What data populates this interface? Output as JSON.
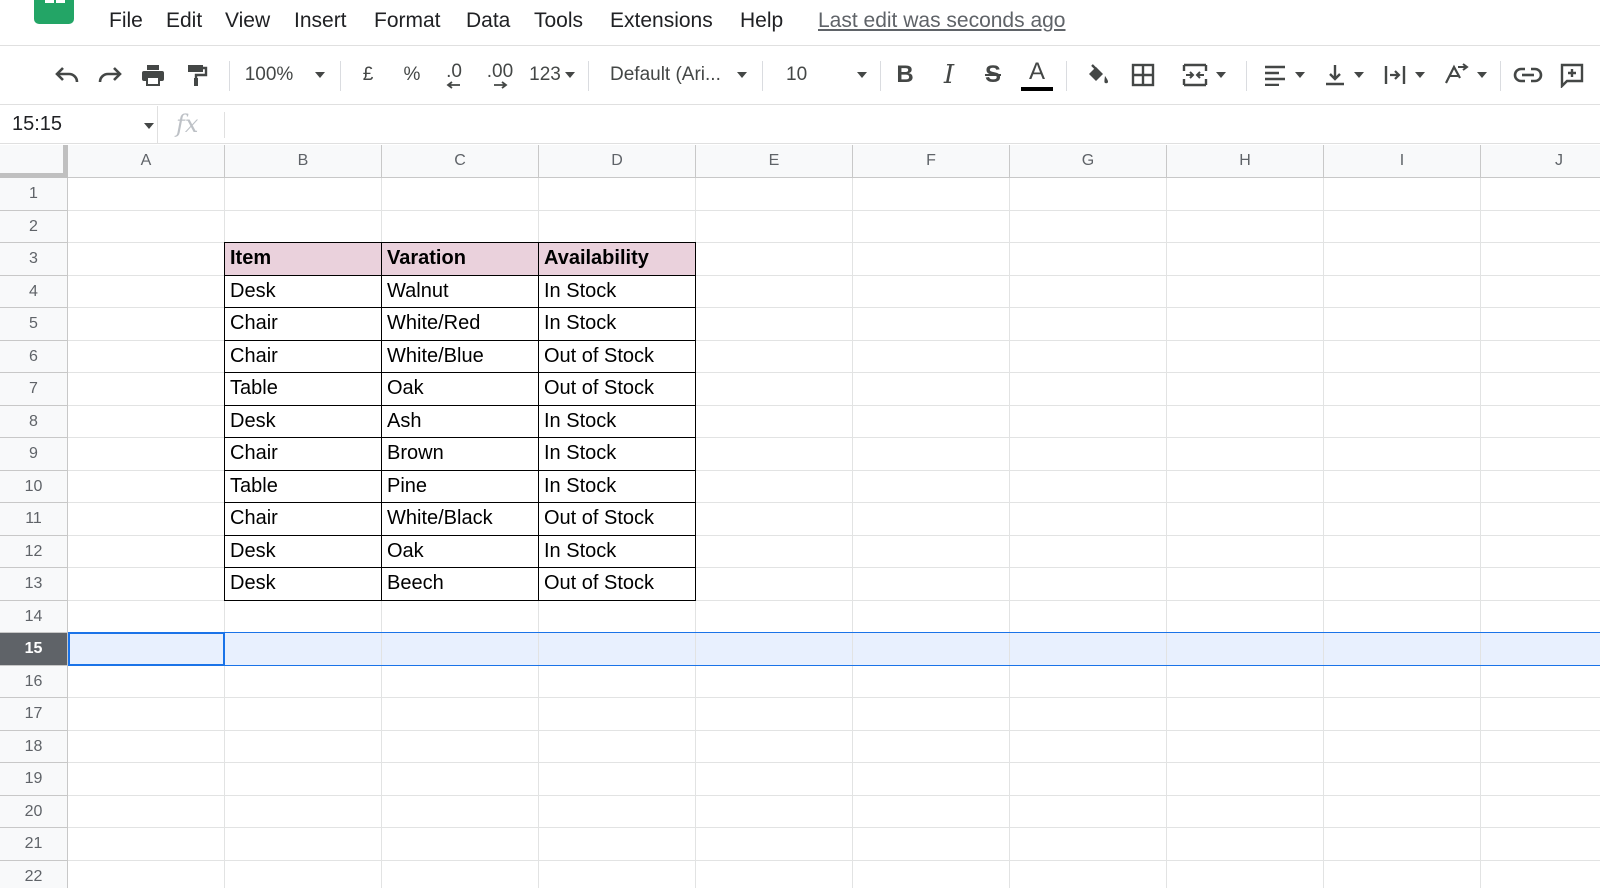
{
  "menubar": {
    "items": [
      "File",
      "Edit",
      "View",
      "Insert",
      "Format",
      "Data",
      "Tools",
      "Extensions",
      "Help"
    ],
    "last_edit": "Last edit was seconds ago"
  },
  "toolbar": {
    "zoom": "100%",
    "currency": "£",
    "percent": "%",
    "decrease_decimal": ".0",
    "increase_decimal": ".00",
    "more_formats": "123",
    "font": "Default (Ari...",
    "font_size": "10",
    "bold": "B",
    "italic": "I",
    "strikethrough": "S",
    "text_color_letter": "A",
    "text_color": "#000000"
  },
  "formula_bar": {
    "name_box": "15:15",
    "fx": "fx",
    "formula": ""
  },
  "sheet": {
    "columns": [
      "A",
      "B",
      "C",
      "D",
      "E",
      "F",
      "G",
      "H",
      "I",
      "J"
    ],
    "rows": [
      "1",
      "2",
      "3",
      "4",
      "5",
      "6",
      "7",
      "8",
      "9",
      "10",
      "11",
      "12",
      "13",
      "14",
      "15",
      "16",
      "17",
      "18",
      "19",
      "20",
      "21",
      "22"
    ],
    "selected_row": "15",
    "header_fill": "#ead1dc",
    "selection_color": "#1a73e8",
    "table_headers": [
      "Item",
      "Varation",
      "Availability"
    ],
    "table_rows": [
      [
        "Desk",
        "Walnut",
        "In Stock"
      ],
      [
        "Chair",
        "White/Red",
        "In Stock"
      ],
      [
        "Chair",
        "White/Blue",
        "Out of Stock"
      ],
      [
        "Table",
        "Oak",
        "Out of Stock"
      ],
      [
        "Desk",
        "Ash",
        "In Stock"
      ],
      [
        "Chair",
        "Brown",
        "In Stock"
      ],
      [
        "Table",
        "Pine",
        "In Stock"
      ],
      [
        "Chair",
        "White/Black",
        "Out of Stock"
      ],
      [
        "Desk",
        "Oak",
        "In Stock"
      ],
      [
        "Desk",
        "Beech",
        "Out of Stock"
      ]
    ]
  }
}
